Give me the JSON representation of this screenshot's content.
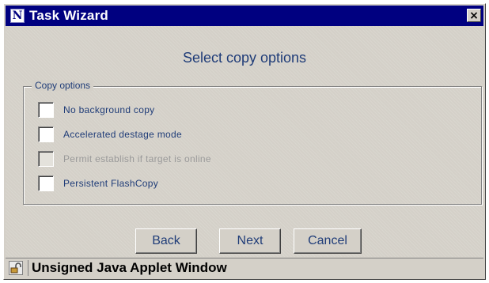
{
  "window": {
    "title": "Task Wizard",
    "app_icon_glyph": "N",
    "close_glyph": "×"
  },
  "main": {
    "heading": "Select copy options",
    "group_label": "Copy options",
    "options": [
      {
        "label": "No background copy",
        "checked": false,
        "enabled": true
      },
      {
        "label": "Accelerated destage mode",
        "checked": false,
        "enabled": true
      },
      {
        "label": "Permit establish if target is online",
        "checked": false,
        "enabled": false
      },
      {
        "label": "Persistent FlashCopy",
        "checked": false,
        "enabled": true
      }
    ]
  },
  "buttons": {
    "back": "Back",
    "next": "Next",
    "cancel": "Cancel"
  },
  "status": {
    "text": "Unsigned Java Applet Window",
    "icon": "unlocked-padlock-icon"
  },
  "colors": {
    "titlebar": "#000080",
    "text_accent": "#1f3c78",
    "background": "#d4d0c8",
    "disabled_text": "#9a9a9a"
  }
}
